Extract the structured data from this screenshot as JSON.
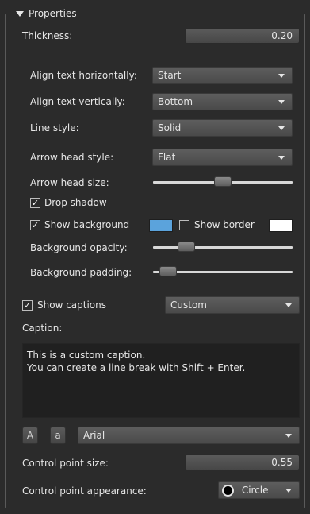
{
  "panel": {
    "title": "Properties"
  },
  "thickness": {
    "label": "Thickness:",
    "value": "0.20"
  },
  "align_horizontal": {
    "label": "Align text horizontally:",
    "value": "Start"
  },
  "align_vertical": {
    "label": "Align text vertically:",
    "value": "Bottom"
  },
  "line_style": {
    "label": "Line style:",
    "value": "Solid"
  },
  "arrow_head_style": {
    "label": "Arrow head style:",
    "value": "Flat"
  },
  "arrow_head_size": {
    "label": "Arrow head size:",
    "level": 0.5
  },
  "drop_shadow": {
    "label": "Drop shadow",
    "checked": true,
    "mark": "✓"
  },
  "show_background": {
    "label": "Show background",
    "checked": true,
    "mark": "✓",
    "color": "#5ba3dc"
  },
  "show_border": {
    "label": "Show border",
    "checked": false,
    "color": "#ffffff"
  },
  "background_opacity": {
    "label": "Background opacity:",
    "level": 0.2
  },
  "background_padding": {
    "label": "Background padding:",
    "level": 0.05
  },
  "show_captions": {
    "label": "Show captions",
    "checked": true,
    "mark": "✓",
    "mode": "Custom"
  },
  "caption": {
    "label": "Caption:",
    "line1": "This is a custom caption.",
    "line2": "You can create a line break with Shift + Enter."
  },
  "font": {
    "upper_label": "A",
    "lower_label": "a",
    "family": "Arial"
  },
  "control_point_size": {
    "label": "Control point size:",
    "value": "0.55"
  },
  "control_point_appearance": {
    "label": "Control point appearance:",
    "value": "Circle",
    "icon": "circle-icon"
  },
  "colors": {
    "background": "#2b2b2b",
    "field": "#4f4f4f",
    "accent": "#5ba3dc"
  }
}
